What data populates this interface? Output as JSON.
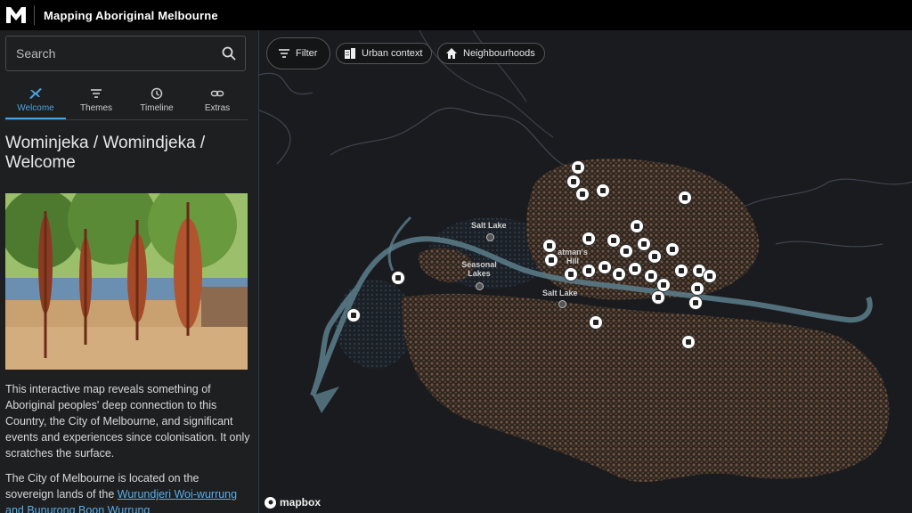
{
  "app": {
    "title": "Mapping Aboriginal Melbourne"
  },
  "sidebar": {
    "search_placeholder": "Search",
    "tabs": [
      {
        "label": "Welcome",
        "icon": "plane-icon",
        "active": true
      },
      {
        "label": "Themes",
        "icon": "filter-lines-icon",
        "active": false
      },
      {
        "label": "Timeline",
        "icon": "clock-icon",
        "active": false
      },
      {
        "label": "Extras",
        "icon": "link-icon",
        "active": false
      }
    ],
    "heading": "Wominjeka / Womindjeka / Welcome",
    "paragraph1": "This interactive map reveals something of Aboriginal peoples' deep connection to this Country, the City of Melbourne, and significant events and experiences since colonisation. It only scratches the surface.",
    "paragraph2_prefix": "The City of Melbourne is located on the sovereign lands of the ",
    "paragraph2_link": "Wurundjeri Woi-wurrung and Bunurong Boon Wurrung"
  },
  "map": {
    "buttons": {
      "filter": "Filter",
      "urban": "Urban context",
      "neighbourhoods": "Neighbourhoods"
    },
    "places": {
      "salt_lake_1": "Salt Lake",
      "seasonal_lakes": "Seasonal Lakes",
      "batmans_hill": "atman's Hill",
      "salt_lake_2": "Salt Lake"
    },
    "attribution": "mapbox"
  },
  "colors": {
    "accent": "#4aa3df",
    "map_bg": "#1a1b1f",
    "sidebar_bg": "#1e1f21",
    "river": "#5c7f8c",
    "vegetation": "#6b4e3e"
  }
}
